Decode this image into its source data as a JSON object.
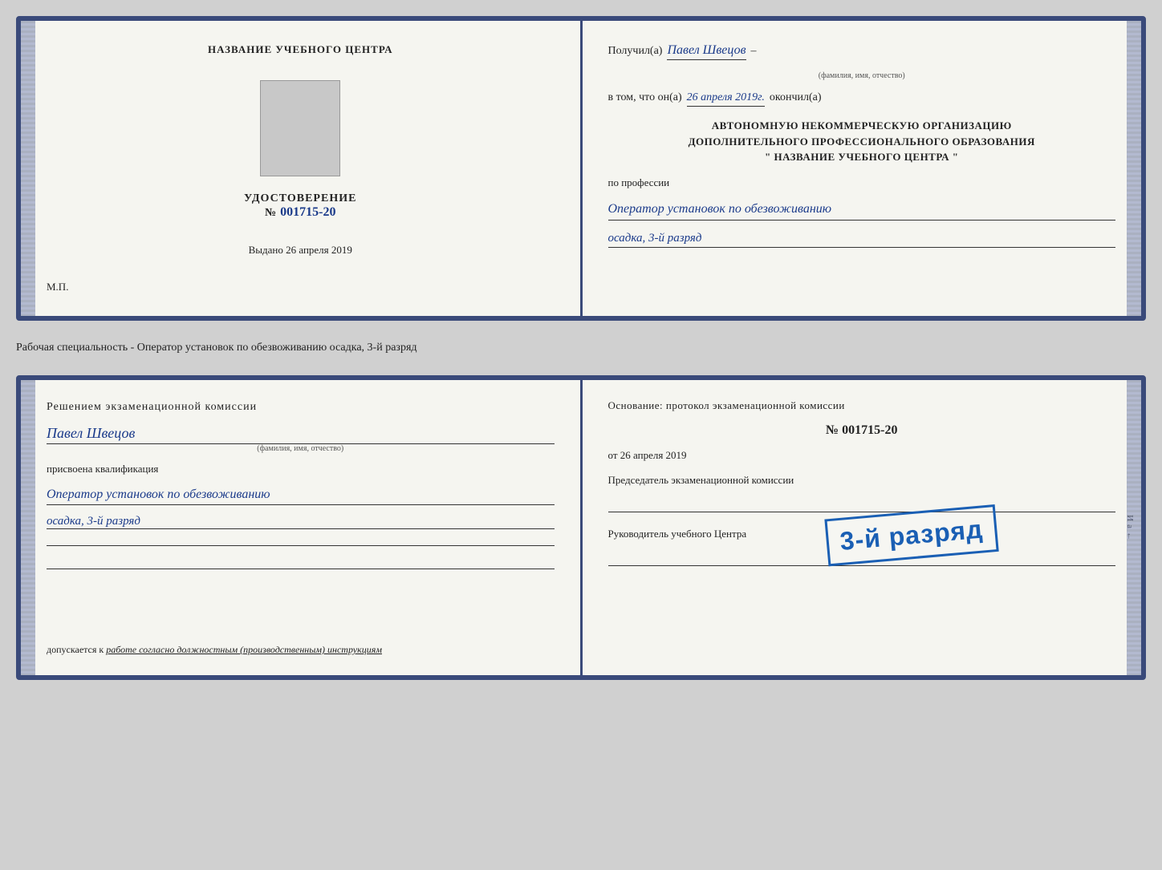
{
  "cert1": {
    "left": {
      "training_center_label": "НАЗВАНИЕ УЧЕБНОГО ЦЕНТРА",
      "cert_type": "УДОСТОВЕРЕНИЕ",
      "cert_number_prefix": "№",
      "cert_number": "001715-20",
      "issued_prefix": "Выдано",
      "issued_date": "26 апреля 2019",
      "mp_label": "М.П."
    },
    "right": {
      "received_prefix": "Получил(а)",
      "received_name": "Павел Швецов",
      "fio_label": "(фамилия, имя, отчество)",
      "dash": "–",
      "in_that_prefix": "в том, что он(а)",
      "in_that_date": "26 апреля 2019г.",
      "finished_label": "окончил(а)",
      "org_line1": "АВТОНОМНУЮ НЕКОММЕРЧЕСКУЮ ОРГАНИЗАЦИЮ",
      "org_line2": "ДОПОЛНИТЕЛЬНОГО ПРОФЕССИОНАЛЬНОГО ОБРАЗОВАНИЯ",
      "org_line3": "\" НАЗВАНИЕ УЧЕБНОГО ЦЕНТРА \"",
      "profession_label": "по профессии",
      "profession_value": "Оператор установок по обезвоживанию",
      "profession_value2": "осадка, 3-й разряд"
    }
  },
  "separator": {
    "text": "Рабочая специальность - Оператор установок по обезвоживанию осадка, 3-й разряд"
  },
  "cert2": {
    "left": {
      "decision_title": "Решением экзаменационной комиссии",
      "person_name": "Павел Швецов",
      "name_sub": "(фамилия, имя, отчество)",
      "assigned_label": "присвоена квалификация",
      "profession": "Оператор установок по обезвоживанию",
      "rank": "осадка, 3-й разряд",
      "allows_prefix": "допускается к",
      "allows_value": "работе согласно должностным (производственным) инструкциям"
    },
    "right": {
      "basis_title": "Основание: протокол экзаменационной комиссии",
      "number_prefix": "№",
      "number_value": "001715-20",
      "date_prefix": "от",
      "date_value": "26 апреля 2019",
      "chairman_label": "Председатель экзаменационной комиссии",
      "head_label": "Руководитель учебного Центра"
    },
    "stamp": {
      "text": "3-й разряд"
    }
  }
}
